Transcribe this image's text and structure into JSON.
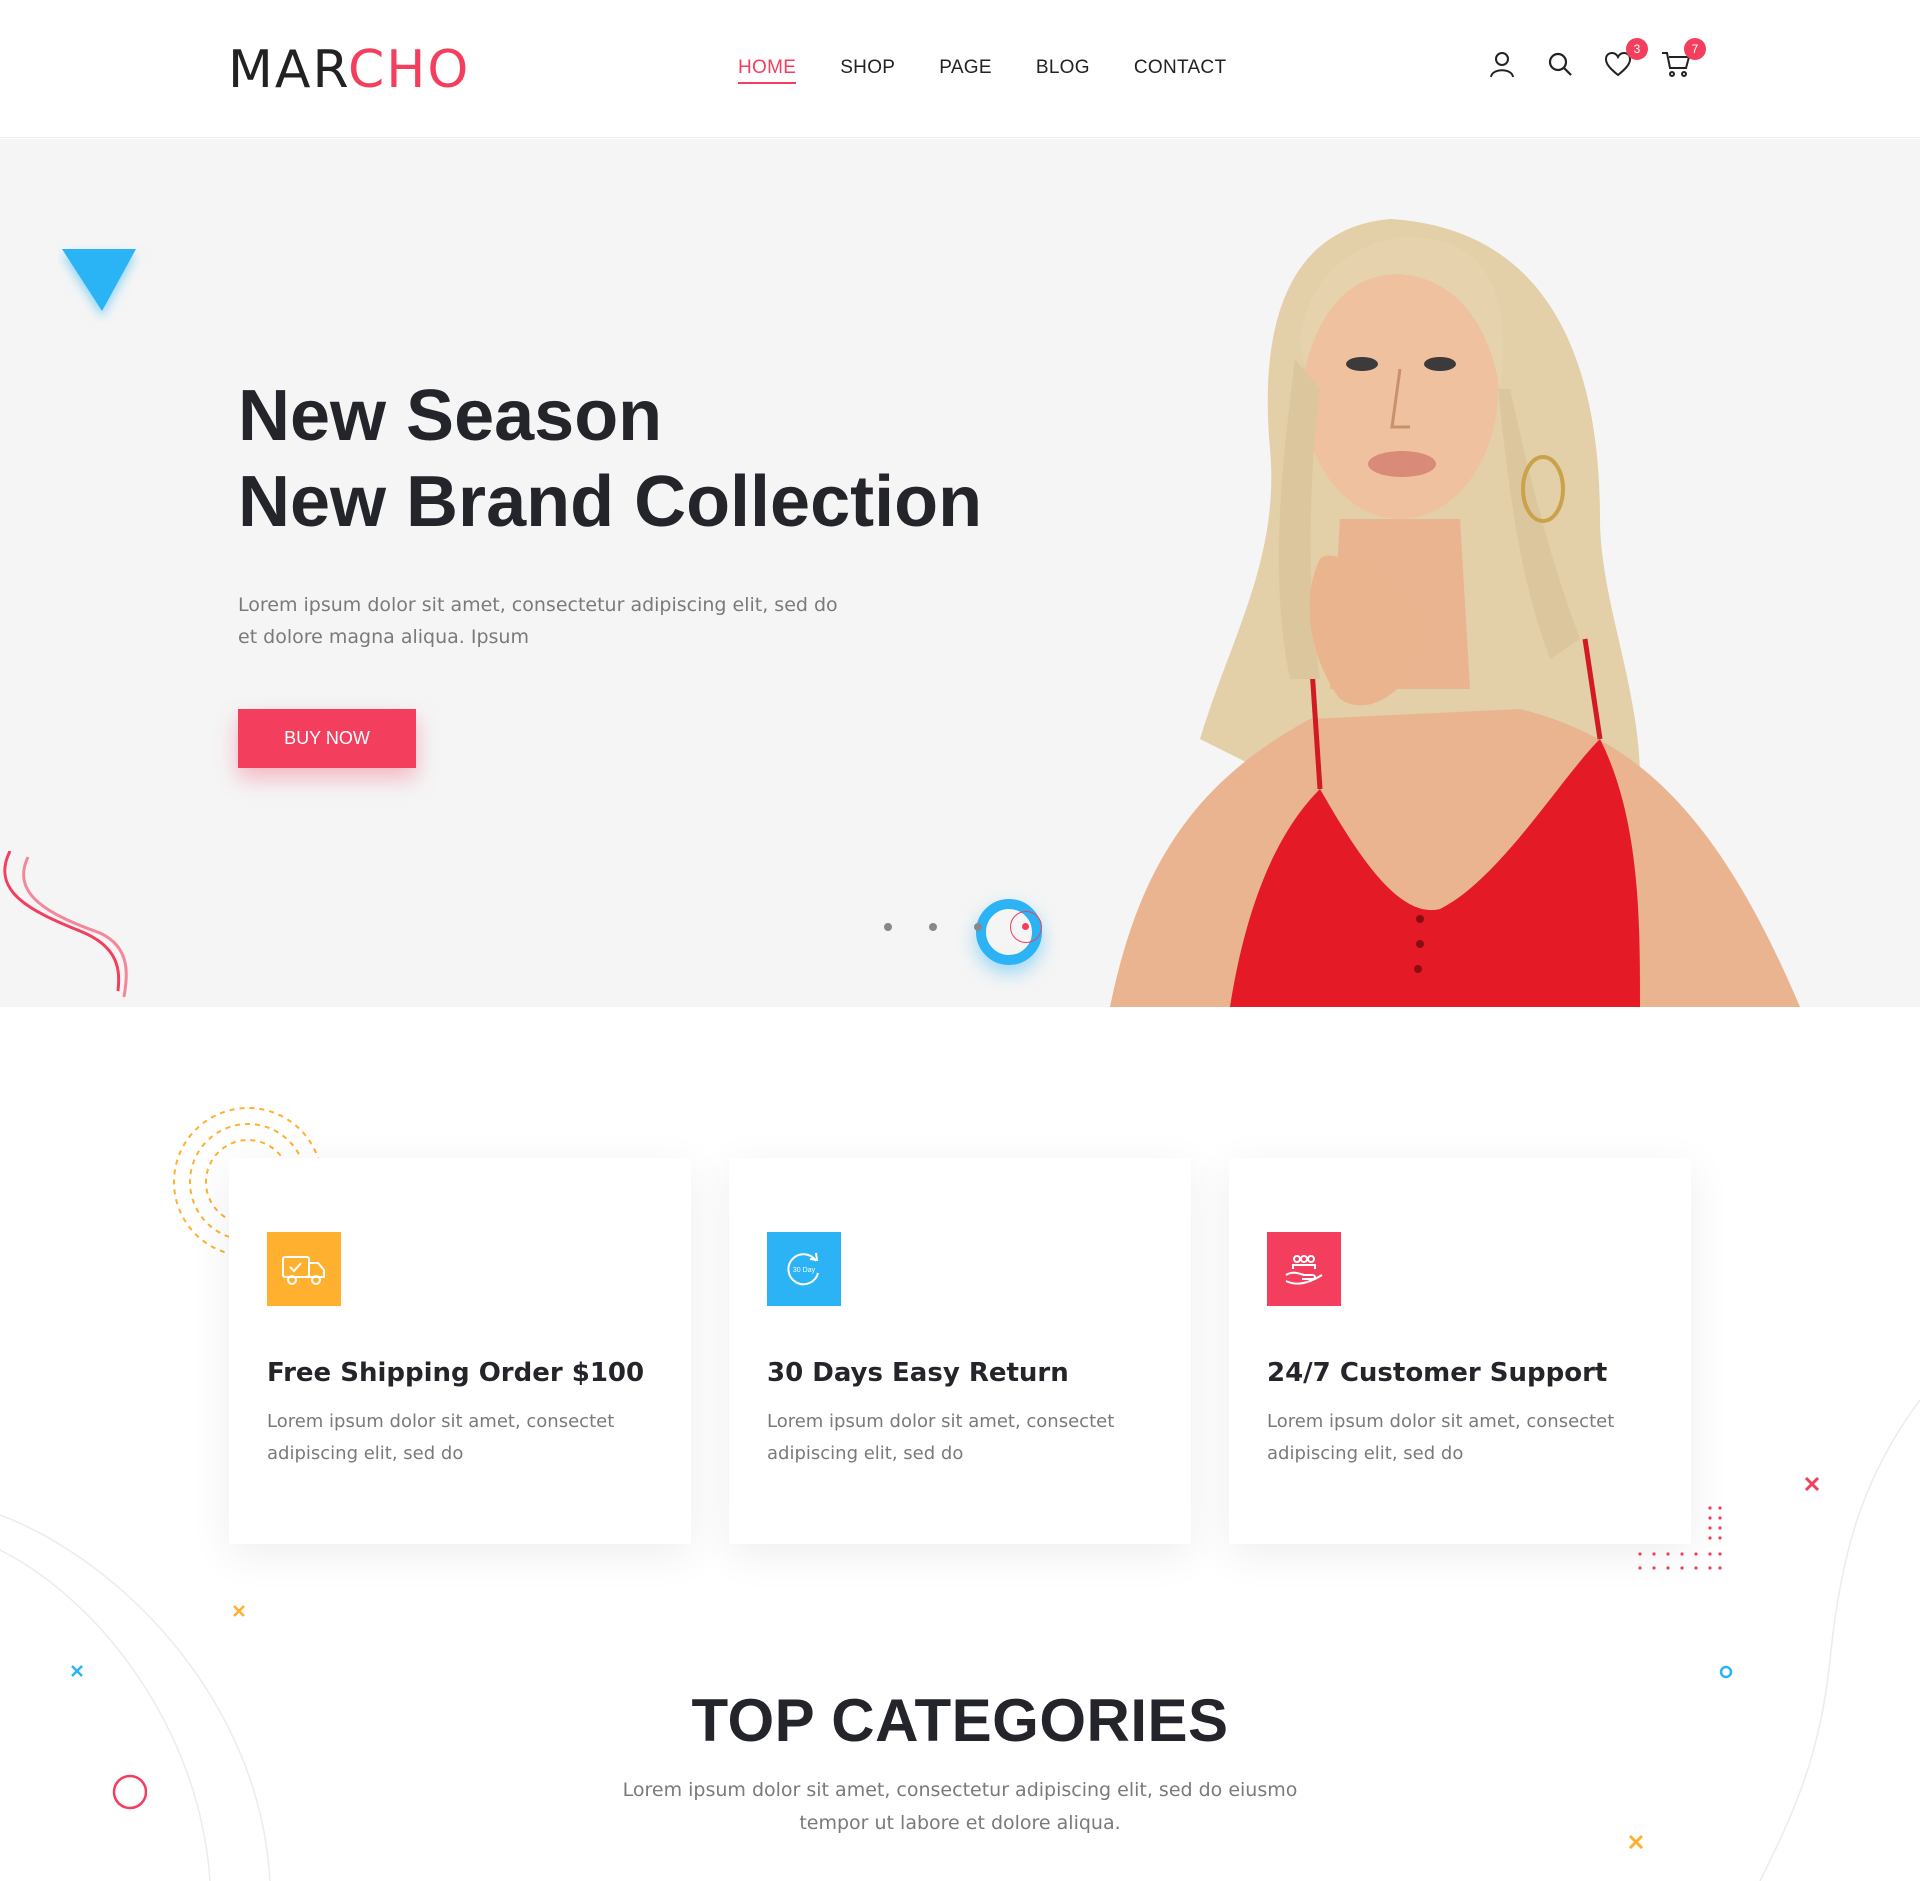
{
  "brand": {
    "logo_part1": "MAR",
    "logo_part2": "CHO"
  },
  "nav": [
    {
      "label": "HOME",
      "active": true
    },
    {
      "label": "SHOP"
    },
    {
      "label": "PAGE"
    },
    {
      "label": "BLOG"
    },
    {
      "label": "CONTACT"
    }
  ],
  "header_icons": {
    "user": "user-icon",
    "search": "search-icon",
    "wishlist": "heart-icon",
    "cart": "cart-icon"
  },
  "badges": {
    "wishlist_count": "3",
    "cart_count": "7"
  },
  "hero": {
    "title_line1": "New Season",
    "title_line2": "New Brand Collection",
    "text": "Lorem ipsum dolor sit amet, consectetur adipiscing elit, sed do et dolore magna aliqua. Ipsum",
    "button_label": "BUY NOW",
    "slides_total": 4,
    "active_slide": 4
  },
  "features": [
    {
      "title": "Free Shipping Order $100",
      "text": "Lorem ipsum dolor sit amet, consectet adipiscing elit, sed do",
      "icon": "truck-icon",
      "color": "#ffb02e"
    },
    {
      "title": "30 Days Easy Return",
      "text": "Lorem ipsum dolor sit amet, consectet adipiscing elit, sed do",
      "icon": "return-icon",
      "icon_text": "30 Day",
      "color": "#2bb3f5"
    },
    {
      "title": "24/7 Customer Support",
      "text": "Lorem ipsum dolor sit amet, consectet adipiscing elit, sed do",
      "icon": "support-icon",
      "color": "#f33e5e"
    }
  ],
  "top_categories": {
    "title": "TOP CATEGORIES",
    "text": "Lorem ipsum dolor sit amet, consectetur adipiscing elit, sed do eiusmo tempor ut labore et dolore aliqua."
  },
  "colors": {
    "accent": "#f33e5e",
    "blue": "#2bb3f5",
    "yellow": "#ffb02e",
    "dark": "#24252a"
  }
}
